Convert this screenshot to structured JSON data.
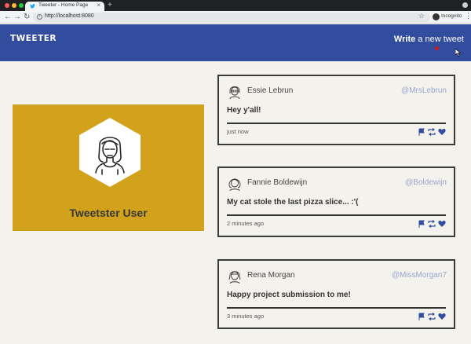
{
  "browser": {
    "tab_title": "Tweeter - Home Page",
    "tab_close": "×",
    "new_tab": "+",
    "url": "http://localhost:8080",
    "incognito_label": "Incognito",
    "nav_back": "←",
    "nav_forward": "→",
    "nav_reload": "↻",
    "star": "☆",
    "menu": "⋮",
    "url_info": "i"
  },
  "header": {
    "logo": "TWEETER",
    "write_bold": "Write",
    "write_rest": " a new tweet"
  },
  "profile": {
    "name": "Tweetster User"
  },
  "tweets": [
    {
      "author": "Essie Lebrun",
      "handle": "@MrsLebrun",
      "text": "Hey y'all!",
      "time": "just now"
    },
    {
      "author": "Fannie Boldewijn",
      "handle": "@Boldewijn",
      "text": "My cat stole the last pizza slice... :'(",
      "time": "2 minutes ago"
    },
    {
      "author": "Rena Morgan",
      "handle": "@MissMorgan7",
      "text": "Happy project submission to me!",
      "time": "3 minutes ago"
    }
  ],
  "colors": {
    "header_bg": "#324d9d",
    "card_bg": "#d2a21c",
    "page_bg": "#f4f2ed",
    "action_icon": "#324d9d",
    "handle": "#9aa6cf"
  },
  "icons": {
    "flag": "flag-icon",
    "retweet": "retweet-icon",
    "like": "heart-icon",
    "avatar": "avatar-icon"
  }
}
